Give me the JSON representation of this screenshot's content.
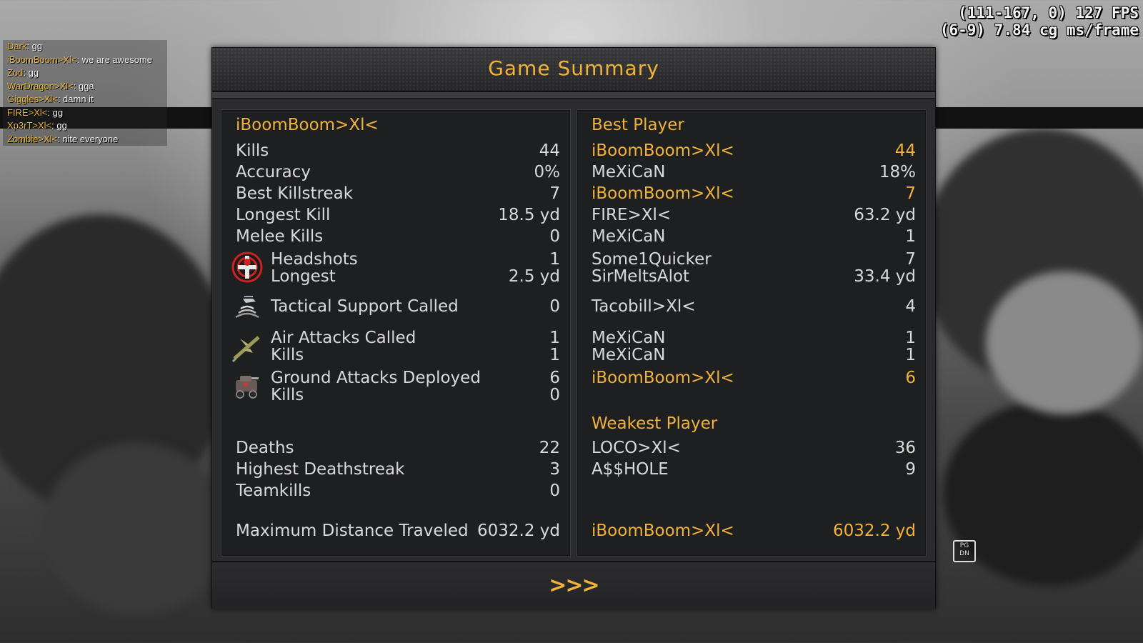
{
  "hud": {
    "debug_line1": "(111-167, 0) 127 FPS",
    "debug_line2": "(6-9) 7.84 cg ms/frame",
    "pgdn_label": "PG DN"
  },
  "chat": [
    {
      "who": "Dark",
      "msg": ": gg"
    },
    {
      "who": "iBoomBoom>Xl<",
      "msg": ": we are awesome"
    },
    {
      "who": "Zod",
      "msg": ": gg"
    },
    {
      "who": "WarDragon>Xl<",
      "msg": ": gga"
    },
    {
      "who": "Giggles>Xl<",
      "msg": ": damn it"
    },
    {
      "who": "FIRE>Xl<",
      "msg": ": gg"
    },
    {
      "who": "Xp3rT>Xl<",
      "msg": ": gg"
    },
    {
      "who": "Zombie>Xl<",
      "msg": ": nite everyone"
    }
  ],
  "summary": {
    "title": "Game Summary",
    "next_label": ">>>",
    "player_name": "iBoomBoom>Xl<",
    "best_header": "Best Player",
    "weakest_header": "Weakest Player",
    "stats": [
      {
        "label": "Kills",
        "value": "44",
        "best_player": "iBoomBoom>Xl<",
        "best_value": "44",
        "is_you": true
      },
      {
        "label": "Accuracy",
        "value": "0%",
        "best_player": "MeXiCaN",
        "best_value": "18%",
        "is_you": false
      },
      {
        "label": "Best Killstreak",
        "value": "7",
        "best_player": "iBoomBoom>Xl<",
        "best_value": "7",
        "is_you": true
      },
      {
        "label": "Longest Kill",
        "value": "18.5 yd",
        "best_player": "FIRE>Xl<",
        "best_value": "63.2 yd",
        "is_you": false
      },
      {
        "label": "Melee Kills",
        "value": "0",
        "best_player": "MeXiCaN",
        "best_value": "1",
        "is_you": false
      },
      {
        "label": "Headshots",
        "value": "1",
        "best_player": "Some1Quicker",
        "best_value": "7",
        "is_you": false
      },
      {
        "label": "Longest",
        "value": "2.5 yd",
        "best_player": "SirMeltsAlot",
        "best_value": "33.4 yd",
        "is_you": false
      },
      {
        "label": "Tactical Support Called",
        "value": "0",
        "best_player": "Tacobill>Xl<",
        "best_value": "4",
        "is_you": false
      },
      {
        "label": "Air Attacks Called",
        "value": "1",
        "best_player": "MeXiCaN",
        "best_value": "1",
        "is_you": false
      },
      {
        "label": "Kills",
        "value": "1",
        "best_player": "MeXiCaN",
        "best_value": "1",
        "is_you": false
      },
      {
        "label": "Ground Attacks Deployed",
        "value": "6",
        "best_player": "iBoomBoom>Xl<",
        "best_value": "6",
        "is_you": true
      },
      {
        "label": "Kills",
        "value": "0",
        "best_player": "",
        "best_value": "",
        "is_you": false
      }
    ],
    "negatives": [
      {
        "label": "Deaths",
        "value": "22",
        "worst_player": "LOCO>Xl<",
        "worst_value": "36"
      },
      {
        "label": "Highest Deathstreak",
        "value": "3",
        "worst_player": "A$$HOLE",
        "worst_value": "9"
      },
      {
        "label": "Teamkills",
        "value": "0",
        "worst_player": "",
        "worst_value": ""
      }
    ],
    "distance": {
      "label": "Maximum Distance Traveled",
      "value": "6032.2 yd",
      "best_player": "iBoomBoom>Xl<",
      "best_value": "6032.2 yd"
    },
    "icons": [
      "headshot-icon",
      "tactical-support-icon",
      "air-attack-icon",
      "ground-attack-icon"
    ],
    "colors": {
      "accent": "#f0b23a",
      "text": "#d9d9d9",
      "panel": "#2b2b2d"
    }
  }
}
